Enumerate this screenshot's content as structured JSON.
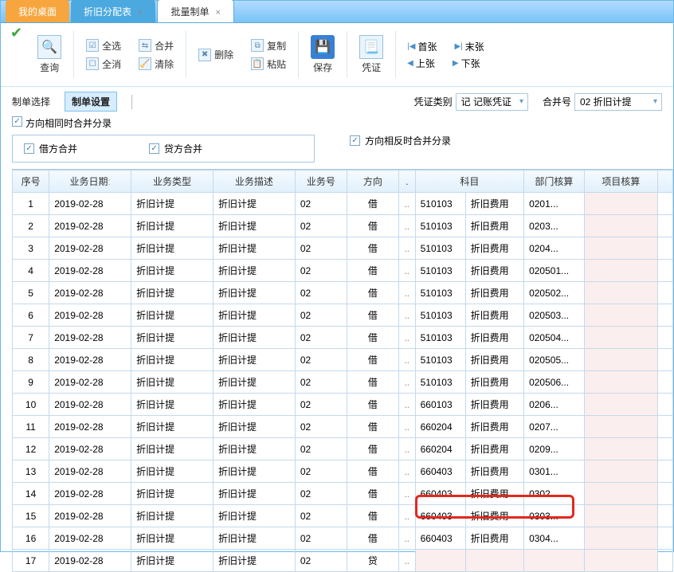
{
  "tabs": {
    "desktop": "我的桌面",
    "alloc": "折旧分配表",
    "batch": "批量制单"
  },
  "toolbar": {
    "query": "查询",
    "selectAll": "全选",
    "deselectAll": "全消",
    "merge": "合并",
    "clear": "清除",
    "delete": "删除",
    "copy": "复制",
    "paste": "粘贴",
    "save": "保存",
    "voucher": "凭证",
    "first": "首张",
    "last": "末张",
    "prev": "上张",
    "next": "下张"
  },
  "sub": {
    "choose": "制单选择",
    "settings": "制单设置",
    "vtype_label": "凭证类别",
    "vtype_value": "记 记账凭证",
    "mergeNo_label": "合并号",
    "mergeNo_value": "02 折旧计提"
  },
  "opts": {
    "sameDir": "方向相同时合并分录",
    "debitMerge": "借方合并",
    "creditMerge": "贷方合并",
    "oppDir": "方向相反时合并分录"
  },
  "cols": {
    "seq": "序号",
    "bizDate": "业务日期",
    "bizType": "业务类型",
    "bizDesc": "业务描述",
    "bizNo": "业务号",
    "dir": "方向",
    "dots": ".",
    "subject": "科目",
    "dept": "部门核算",
    "proj": "项目核算"
  },
  "rows": [
    {
      "seq": "1",
      "date": "2019-02-28",
      "type": "折旧计提",
      "desc": "折旧计提",
      "no": "02",
      "dir": "借",
      "code": "510103",
      "name": "折旧费用",
      "dept": "0201..."
    },
    {
      "seq": "2",
      "date": "2019-02-28",
      "type": "折旧计提",
      "desc": "折旧计提",
      "no": "02",
      "dir": "借",
      "code": "510103",
      "name": "折旧费用",
      "dept": "0203..."
    },
    {
      "seq": "3",
      "date": "2019-02-28",
      "type": "折旧计提",
      "desc": "折旧计提",
      "no": "02",
      "dir": "借",
      "code": "510103",
      "name": "折旧费用",
      "dept": "0204..."
    },
    {
      "seq": "4",
      "date": "2019-02-28",
      "type": "折旧计提",
      "desc": "折旧计提",
      "no": "02",
      "dir": "借",
      "code": "510103",
      "name": "折旧费用",
      "dept": "020501..."
    },
    {
      "seq": "5",
      "date": "2019-02-28",
      "type": "折旧计提",
      "desc": "折旧计提",
      "no": "02",
      "dir": "借",
      "code": "510103",
      "name": "折旧费用",
      "dept": "020502..."
    },
    {
      "seq": "6",
      "date": "2019-02-28",
      "type": "折旧计提",
      "desc": "折旧计提",
      "no": "02",
      "dir": "借",
      "code": "510103",
      "name": "折旧费用",
      "dept": "020503..."
    },
    {
      "seq": "7",
      "date": "2019-02-28",
      "type": "折旧计提",
      "desc": "折旧计提",
      "no": "02",
      "dir": "借",
      "code": "510103",
      "name": "折旧费用",
      "dept": "020504..."
    },
    {
      "seq": "8",
      "date": "2019-02-28",
      "type": "折旧计提",
      "desc": "折旧计提",
      "no": "02",
      "dir": "借",
      "code": "510103",
      "name": "折旧费用",
      "dept": "020505..."
    },
    {
      "seq": "9",
      "date": "2019-02-28",
      "type": "折旧计提",
      "desc": "折旧计提",
      "no": "02",
      "dir": "借",
      "code": "510103",
      "name": "折旧费用",
      "dept": "020506..."
    },
    {
      "seq": "10",
      "date": "2019-02-28",
      "type": "折旧计提",
      "desc": "折旧计提",
      "no": "02",
      "dir": "借",
      "code": "660103",
      "name": "折旧费用",
      "dept": "0206..."
    },
    {
      "seq": "11",
      "date": "2019-02-28",
      "type": "折旧计提",
      "desc": "折旧计提",
      "no": "02",
      "dir": "借",
      "code": "660204",
      "name": "折旧费用",
      "dept": "0207..."
    },
    {
      "seq": "12",
      "date": "2019-02-28",
      "type": "折旧计提",
      "desc": "折旧计提",
      "no": "02",
      "dir": "借",
      "code": "660204",
      "name": "折旧费用",
      "dept": "0209..."
    },
    {
      "seq": "13",
      "date": "2019-02-28",
      "type": "折旧计提",
      "desc": "折旧计提",
      "no": "02",
      "dir": "借",
      "code": "660403",
      "name": "折旧费用",
      "dept": "0301..."
    },
    {
      "seq": "14",
      "date": "2019-02-28",
      "type": "折旧计提",
      "desc": "折旧计提",
      "no": "02",
      "dir": "借",
      "code": "660403",
      "name": "折旧费用",
      "dept": "0302..."
    },
    {
      "seq": "15",
      "date": "2019-02-28",
      "type": "折旧计提",
      "desc": "折旧计提",
      "no": "02",
      "dir": "借",
      "code": "660403",
      "name": "折旧费用",
      "dept": "0303..."
    },
    {
      "seq": "16",
      "date": "2019-02-28",
      "type": "折旧计提",
      "desc": "折旧计提",
      "no": "02",
      "dir": "借",
      "code": "660403",
      "name": "折旧费用",
      "dept": "0304..."
    },
    {
      "seq": "17",
      "date": "2019-02-28",
      "type": "折旧计提",
      "desc": "折旧计提",
      "no": "02",
      "dir": "贷",
      "code": "",
      "name": "",
      "dept": ""
    }
  ]
}
